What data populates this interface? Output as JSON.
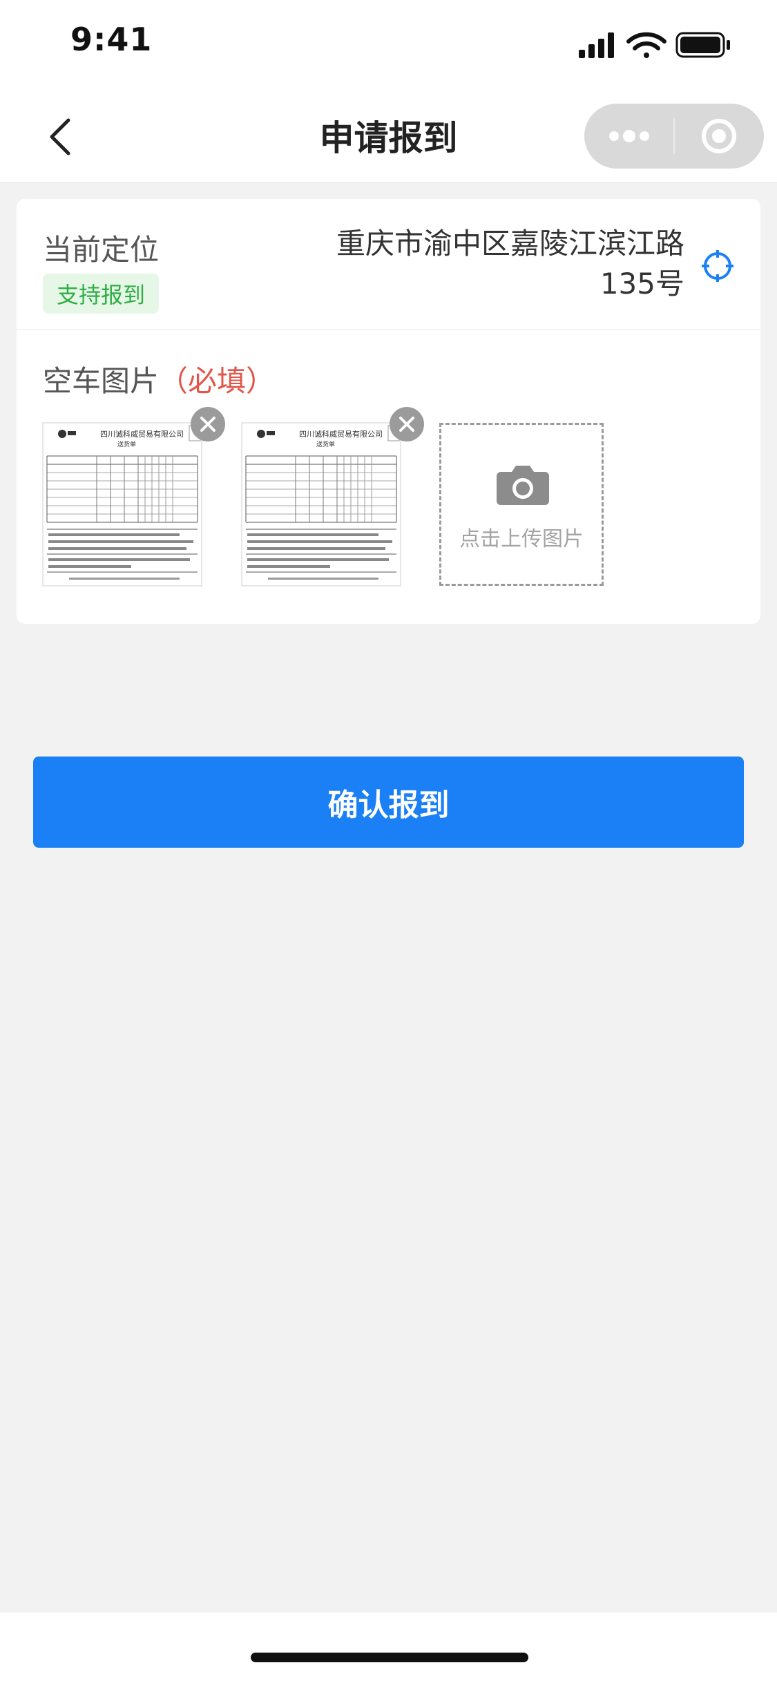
{
  "status_bar": {
    "time": "9:41",
    "icons": [
      "signal-icon",
      "wifi-icon",
      "battery-icon"
    ]
  },
  "nav": {
    "title": "申请报到",
    "back_icon": "chevron-left-icon",
    "more_icon": "more-dots-icon",
    "close_icon": "target-circle-icon"
  },
  "location": {
    "label": "当前定位",
    "badge": "支持报到",
    "address_line1": "重庆市渝中区嘉陵江滨江路",
    "address_line2": "135号",
    "locate_icon": "crosshair-icon"
  },
  "photos": {
    "title": "空车图片",
    "required": "（必填）",
    "upload_label": "点击上传图片",
    "items": [
      {
        "company": "四川诚科威贸易有限公司",
        "doc": "送货单"
      },
      {
        "company": "四川诚科威贸易有限公司",
        "doc": "送货单"
      }
    ]
  },
  "actions": {
    "confirm": "确认报到"
  },
  "colors": {
    "accent": "#1b80f5",
    "required": "#e2554a",
    "badge_text": "#2fae44",
    "badge_bg": "#e6f7e8",
    "page_bg": "#f2f2f2"
  }
}
